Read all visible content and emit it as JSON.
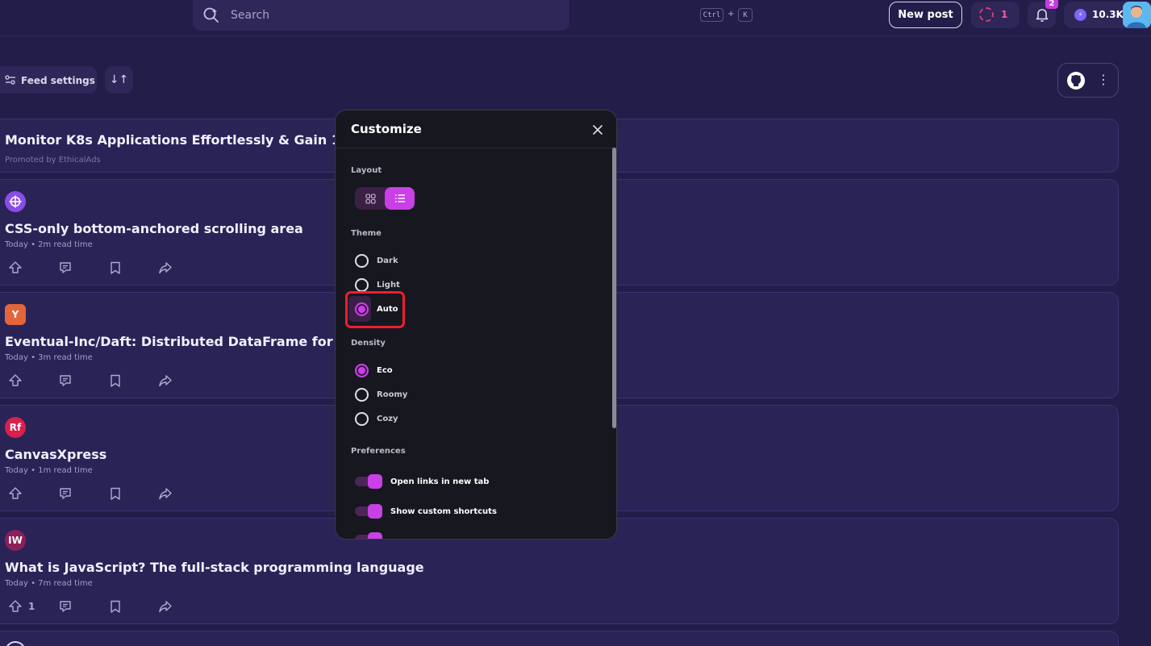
{
  "header": {
    "search_placeholder": "Search",
    "shortcut_ctrl": "Ctrl",
    "shortcut_plus": "+",
    "shortcut_key": "K",
    "new_post_label": "New post",
    "streak_count": "1",
    "notifications_count": "2",
    "reputation": "10.3K"
  },
  "feed_controls": {
    "feed_settings_label": "Feed settings",
    "sort_label": "↓↑",
    "more_label": "⋮"
  },
  "cards": [
    {
      "title": "Monitor K8s Applications Effortlessly & Gain 100% F",
      "meta": "Promoted by EthicalAds"
    },
    {
      "title": "CSS-only bottom-anchored scrolling area",
      "meta": "Today • 2m read time",
      "upvotes": ""
    },
    {
      "title": "Eventual-Inc/Daft: Distributed DataFrame for Python",
      "meta": "Today • 3m read time",
      "upvotes": "",
      "source_letter": "Y"
    },
    {
      "title": "CanvasXpress",
      "meta": "Today • 1m read time",
      "upvotes": "",
      "source_letter": "Rf"
    },
    {
      "title": "What is JavaScript? The full-stack programming language",
      "meta": "Today • 7m read time",
      "upvotes": "1",
      "source_letter": "IW"
    }
  ],
  "modal": {
    "title": "Customize",
    "layout_heading": "Layout",
    "theme_heading": "Theme",
    "theme_options": [
      "Dark",
      "Light",
      "Auto"
    ],
    "theme_selected": "Auto",
    "density_heading": "Density",
    "density_options": [
      "Eco",
      "Roomy",
      "Cozy"
    ],
    "density_selected": "Eco",
    "preferences_heading": "Preferences",
    "preferences": [
      {
        "label": "Open links in new tab",
        "enabled": true
      },
      {
        "label": "Show custom shortcuts",
        "enabled": true
      }
    ]
  },
  "colors": {
    "background": "#231d4a",
    "card": "#2a2356",
    "accent": "#c940e6",
    "modal": "#17171f",
    "highlight": "#f01d2f"
  }
}
